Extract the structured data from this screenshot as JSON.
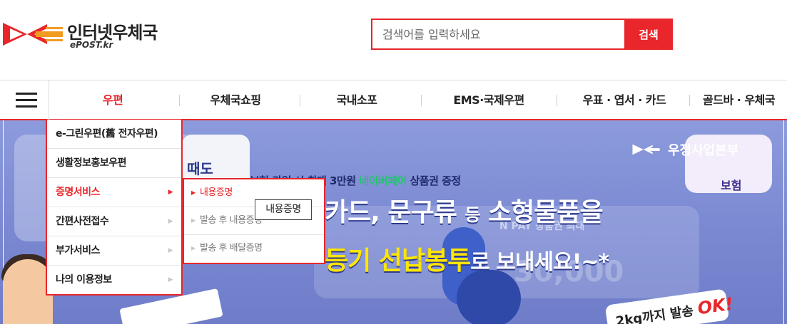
{
  "header": {
    "logo_title": "인터넷우체국",
    "logo_sub": "ePOST.kr",
    "search_placeholder": "검색어를 입력하세요",
    "search_button": "검색"
  },
  "gnb": {
    "items": [
      {
        "label": "우편",
        "active": true
      },
      {
        "label": "우체국쇼핑"
      },
      {
        "label": "국내소포"
      },
      {
        "label": "EMS·국제우편"
      },
      {
        "label": "우표 · 엽서 · 카드"
      },
      {
        "label": "골드바 · 우체국"
      }
    ]
  },
  "dropdown": {
    "items": [
      {
        "label": "e-그린우편(舊 전자우편)"
      },
      {
        "label": "생활정보홍보우편"
      },
      {
        "label": "증명서비스",
        "active": true
      },
      {
        "label": "간편사전접수"
      },
      {
        "label": "부가서비스"
      },
      {
        "label": "나의 이용정보"
      }
    ],
    "sub_items": [
      {
        "label": "내용증명",
        "active": true
      },
      {
        "label": "발송 후 내용증명"
      },
      {
        "label": "발송 후 배달증명"
      }
    ],
    "tooltip": "내용증명"
  },
  "banner": {
    "phone_text": "때도",
    "top_line_prefix": "보험 가입 시 최대 3만원 ",
    "top_line_green": "네이버페이",
    "top_line_suffix": " 상품권 증정",
    "headline1_a": "카드, 문구류 ",
    "headline1_b": "등",
    "headline1_c": " 소형물품을",
    "headline2_a": "등기 선납봉투",
    "headline2_b": "로 보내세요!~*",
    "gauge_text": "N PAY 상품권 최대",
    "big_amount": "30,000",
    "brand": "우정사업본부",
    "badge_text": "보험",
    "note_text": "2kg까지 발송 ",
    "note_ok": "OK!"
  },
  "colors": {
    "brand_red": "#e8262b",
    "banner_bg": "#8c9bdc",
    "highlight_yellow": "#ffe600",
    "naverpay_green": "#1fc66a"
  },
  "icons": [
    "epost-logo-icon",
    "hamburger-menu-icon",
    "chevron-right-icon",
    "triangle-right-icon"
  ]
}
